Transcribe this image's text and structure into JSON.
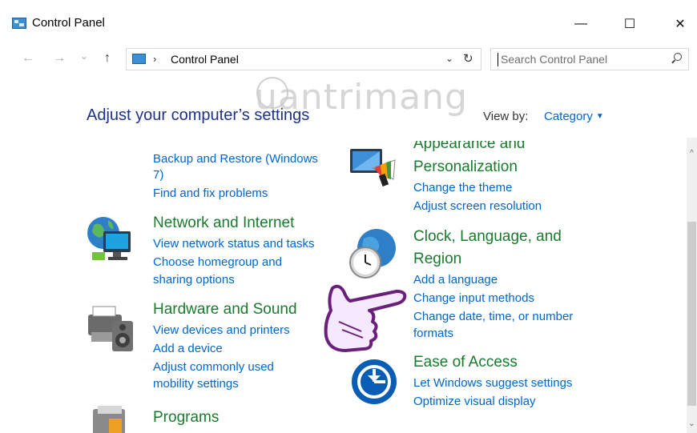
{
  "window": {
    "title": "Control Panel",
    "minimize_glyph": "—",
    "maximize_glyph": "☐",
    "close_glyph": "✕"
  },
  "nav": {
    "back_glyph": "←",
    "forward_glyph": "→",
    "recent_glyph": "⌄",
    "up_glyph": "↑"
  },
  "address": {
    "separator": "›",
    "path": "Control Panel",
    "dropdown_glyph": "⌄",
    "refresh_glyph": "↻"
  },
  "search": {
    "placeholder": "Search Control Panel"
  },
  "main": {
    "heading": "Adjust your computer’s settings",
    "view_by_label": "View by:",
    "view_by_value": "Category",
    "watermark": "uantrimang"
  },
  "categories": {
    "system_links": {
      "backup_1": "Backup and Restore (Windows",
      "backup_2": "7)",
      "find_fix": "Find and fix problems"
    },
    "appearance": {
      "title_1": "Appearance and",
      "title_2": "Personalization",
      "link_theme": "Change the theme",
      "link_resolution": "Adjust screen resolution"
    },
    "network": {
      "title": "Network and Internet",
      "link_status": "View network status and tasks",
      "link_homegroup_1": "Choose homegroup and",
      "link_homegroup_2": "sharing options"
    },
    "clock": {
      "title_1": "Clock, Language, and",
      "title_2": "Region",
      "link_language": "Add a language",
      "link_input": "Change input methods",
      "link_date_1": "Change date, time, or number",
      "link_date_2": "formats"
    },
    "hardware": {
      "title": "Hardware and Sound",
      "link_devices": "View devices and printers",
      "link_add": "Add a device",
      "link_mobility_1": "Adjust commonly used",
      "link_mobility_2": "mobility settings"
    },
    "ease": {
      "title": "Ease of Access",
      "link_suggest": "Let Windows suggest settings",
      "link_optimize": "Optimize visual display"
    },
    "programs": {
      "title": "Programs"
    }
  },
  "colors": {
    "heading": "#1e3287",
    "category_title": "#1a7a2e",
    "link": "#0066cc"
  }
}
